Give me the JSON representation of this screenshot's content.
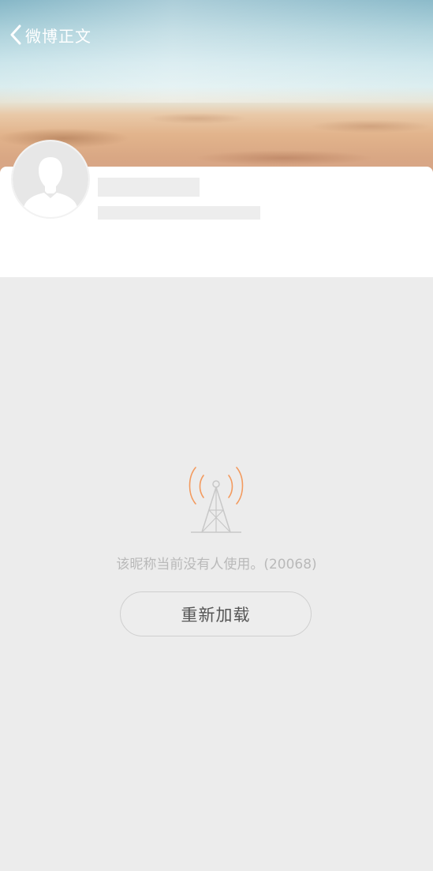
{
  "header": {
    "back_label": "微博正文"
  },
  "profile": {
    "avatar": "default-avatar"
  },
  "error": {
    "message": "该昵称当前没有人使用。(20068)",
    "reload_label": "重新加载",
    "icon": "signal-tower-icon"
  },
  "colors": {
    "background": "#ececec",
    "accent": "#f39a5e",
    "error_text": "#b9b9b9"
  }
}
